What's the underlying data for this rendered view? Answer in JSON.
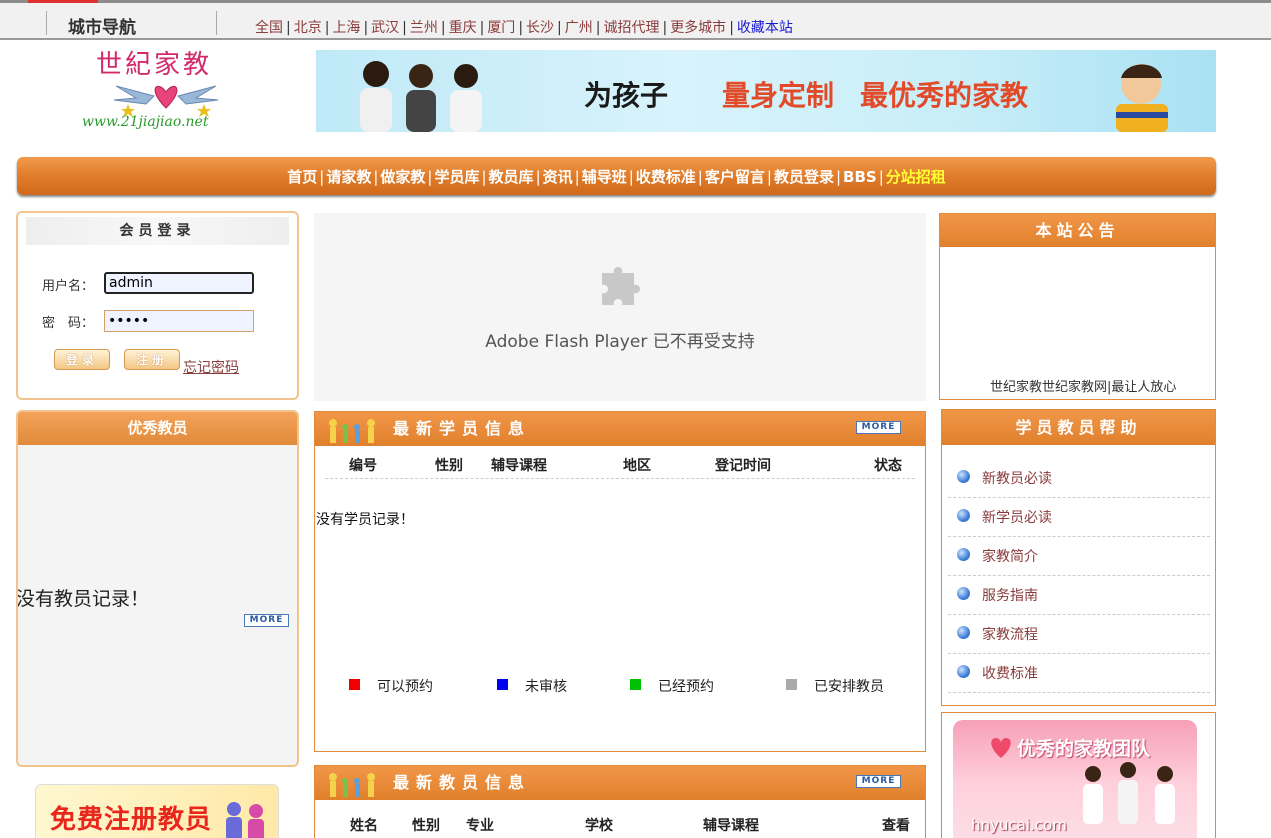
{
  "topbar": {
    "title": "城市导航",
    "cities": [
      "全国",
      "北京",
      "上海",
      "武汉",
      "兰州",
      "重庆",
      "厦门",
      "长沙",
      "广州",
      "诚招代理",
      "更多城市"
    ],
    "favorite": "收藏本站"
  },
  "logo": {
    "name": "世紀家教",
    "url": "www.21jiajiao.net"
  },
  "banner": {
    "part1": "为孩子",
    "part2": "量身定制",
    "part3": "最优秀的家教"
  },
  "mainnav": {
    "items": [
      "首页",
      "请家教",
      "做家教",
      "学员库",
      "教员库",
      "资讯",
      "辅导班",
      "收费标准",
      "客户留言",
      "教员登录",
      "BBS"
    ],
    "highlight": "分站招租"
  },
  "login": {
    "title": "会员登录",
    "username_label": "用户名：",
    "username_value": "admin",
    "password_label": "密　码：",
    "password_value": "•••••",
    "login_button": "登录",
    "register_button": "注册",
    "forgot_link": "忘记密码"
  },
  "teachers": {
    "title": "优秀教员",
    "empty_text": "没有教员记录！",
    "more": "MORE"
  },
  "register_ad": {
    "text": "免费注册教员"
  },
  "flash": {
    "message": "Adobe Flash Player 已不再受支持"
  },
  "students": {
    "title": "最新学员信息",
    "more": "MORE",
    "columns": [
      "编号",
      "性别",
      "辅导课程",
      "地区",
      "登记时间",
      "状态"
    ],
    "empty_text": "没有学员记录！",
    "legend": [
      {
        "label": "可以预约",
        "color": "#f00000"
      },
      {
        "label": "未审核",
        "color": "#0000f0"
      },
      {
        "label": "已经预约",
        "color": "#00c000"
      },
      {
        "label": "已安排教员",
        "color": "#aaaaaa"
      }
    ]
  },
  "teacher_info": {
    "title": "最新教员信息",
    "more": "MORE",
    "columns": [
      "姓名",
      "性别",
      "专业",
      "学校",
      "辅导课程",
      "查看"
    ]
  },
  "notice": {
    "title": "本站公告",
    "marquee": "世纪家教世纪家教网|最让人放心"
  },
  "help": {
    "title": "学员教员帮助",
    "items": [
      "新教员必读",
      "新学员必读",
      "家教简介",
      "服务指南",
      "家教流程",
      "收费标准"
    ]
  },
  "team_ad": {
    "title": "优秀的家教团队",
    "url": "hnyucai.com"
  },
  "colors": {
    "orange": "#e0802c",
    "link": "#8a3b3b",
    "highlight": "#ffff33"
  }
}
